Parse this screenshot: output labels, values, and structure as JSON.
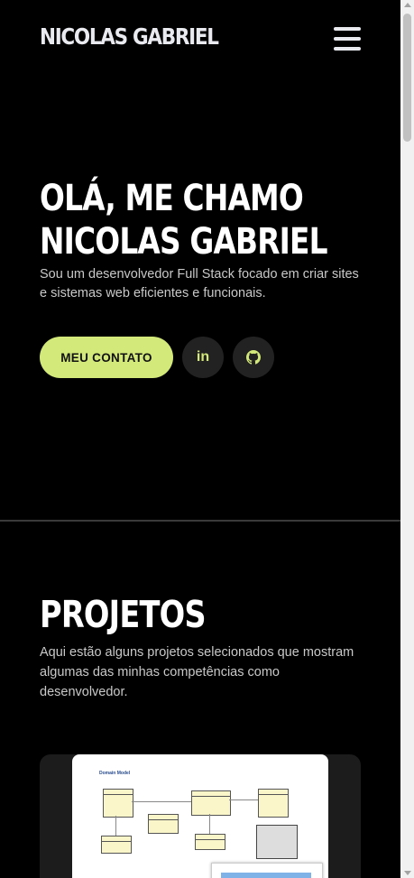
{
  "header": {
    "brand": "NICOLAS GABRIEL",
    "menu_icon": "hamburger-menu-icon"
  },
  "hero": {
    "title_line1": "OLÁ, ME CHAMO",
    "title_line2": "NICOLAS GABRIEL",
    "subtitle": "Sou um desenvolvedor Full Stack focado em criar sites e sistemas web eficientes e funcionais.",
    "contact_button": "MEU CONTATO",
    "social": [
      {
        "name": "linkedin",
        "icon": "linkedin-icon",
        "glyph": "in"
      },
      {
        "name": "github",
        "icon": "github-icon"
      }
    ]
  },
  "projects": {
    "title": "PROJETOS",
    "subtitle": "Aqui estão alguns projetos selecionados que mostram algumas das minhas competências como desenvolvedor.",
    "first_thumbnail_title": "Domain Model"
  },
  "colors": {
    "background": "#000000",
    "accent": "#d3e97a",
    "social_button": "#222222",
    "card": "#1c1c1c"
  }
}
